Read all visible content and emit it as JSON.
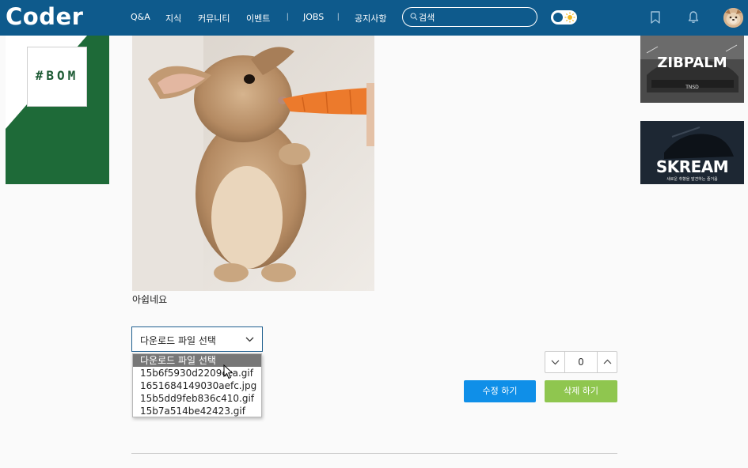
{
  "header": {
    "logo": "Coder",
    "nav": [
      "Q&A",
      "지식",
      "커뮤니티",
      "이벤트",
      "JOBS",
      "공지사항"
    ],
    "separator": "|",
    "search_placeholder": "검색"
  },
  "left_ad": {
    "text": "#BOM"
  },
  "right_ads": [
    {
      "title": "ZIBPALM",
      "subtitle": "TNSD"
    },
    {
      "title": "SKREAM",
      "subtitle": "새로운 취향을 발견하는 즐거움"
    }
  ],
  "post": {
    "caption": "아쉽네요"
  },
  "file_select": {
    "label": "다운로드 파일 선택",
    "options": [
      "다운로드 파일 선택",
      "15b6f5930d2209cca.gif",
      "1651684149030aefc.jpg",
      "15b5dd9feb836c410.gif",
      "15b7a514be42423.gif"
    ]
  },
  "vote": {
    "value": "0"
  },
  "actions": {
    "edit": "수정 하기",
    "delete": "삭제 하기"
  },
  "colors": {
    "header": "#0e5a8c",
    "edit": "#0f8fe8",
    "delete": "#8fc64f",
    "ad_green": "#1e6a38"
  }
}
